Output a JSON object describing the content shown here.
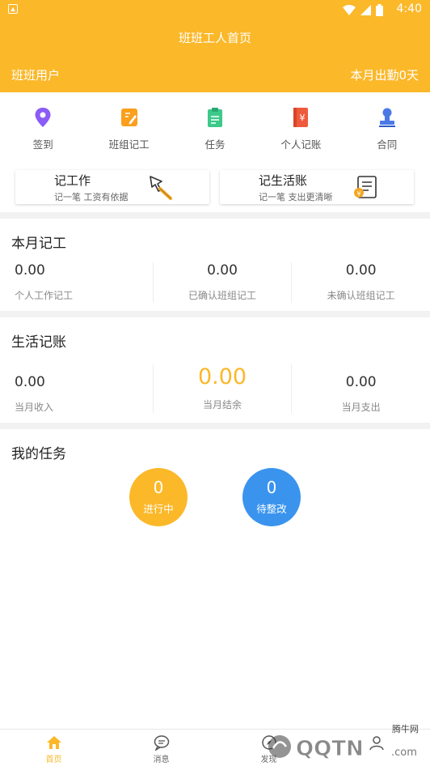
{
  "status": {
    "time": "4:40"
  },
  "header": {
    "title": "班班工人首页",
    "user": "班班用户",
    "attendance": "本月出勤0天"
  },
  "menu": [
    {
      "label": "签到",
      "icon": "location-pin-icon",
      "color": "#8b5cf6"
    },
    {
      "label": "班组记工",
      "icon": "edit-note-icon",
      "color": "#fb9f1c"
    },
    {
      "label": "任务",
      "icon": "clipboard-icon",
      "color": "#3cc98a"
    },
    {
      "label": "个人记账",
      "icon": "ledger-book-icon",
      "color": "#f05a3c"
    },
    {
      "label": "合同",
      "icon": "stamp-icon",
      "color": "#4a79e6"
    }
  ],
  "quick": {
    "work": {
      "title": "记工作",
      "subtitle": "记一笔 工资有依据",
      "icon": "trowel-icon"
    },
    "life": {
      "title": "记生活账",
      "subtitle": "记一笔 支出更清晰",
      "icon": "receipt-icon"
    }
  },
  "monthly": {
    "title": "本月记工",
    "stats": [
      {
        "value": "0.00",
        "label": "个人工作记工"
      },
      {
        "value": "0.00",
        "label": "已确认班组记工"
      },
      {
        "value": "0.00",
        "label": "未确认班组记工"
      }
    ]
  },
  "ledger": {
    "title": "生活记账",
    "income": {
      "value": "0.00",
      "label": "当月收入"
    },
    "balance": {
      "value": "0.00",
      "label": "当月结余"
    },
    "expense": {
      "value": "0.00",
      "label": "当月支出"
    }
  },
  "tasks": {
    "title": "我的任务",
    "in_progress": {
      "count": "0",
      "label": "进行中",
      "color": "#fbb829"
    },
    "to_fix": {
      "count": "0",
      "label": "待整改",
      "color": "#3a94ee"
    }
  },
  "tabbar": [
    {
      "label": "首页",
      "icon": "home-icon",
      "active": true
    },
    {
      "label": "消息",
      "icon": "message-icon",
      "active": false
    },
    {
      "label": "发现",
      "icon": "discover-icon",
      "active": false
    },
    {
      "label": "",
      "icon": "profile-icon",
      "active": false
    }
  ],
  "watermark": {
    "text": "QQTN.com",
    "sub": "腾牛网"
  },
  "colors": {
    "brand": "#fbb829",
    "blue": "#3a94ee"
  }
}
